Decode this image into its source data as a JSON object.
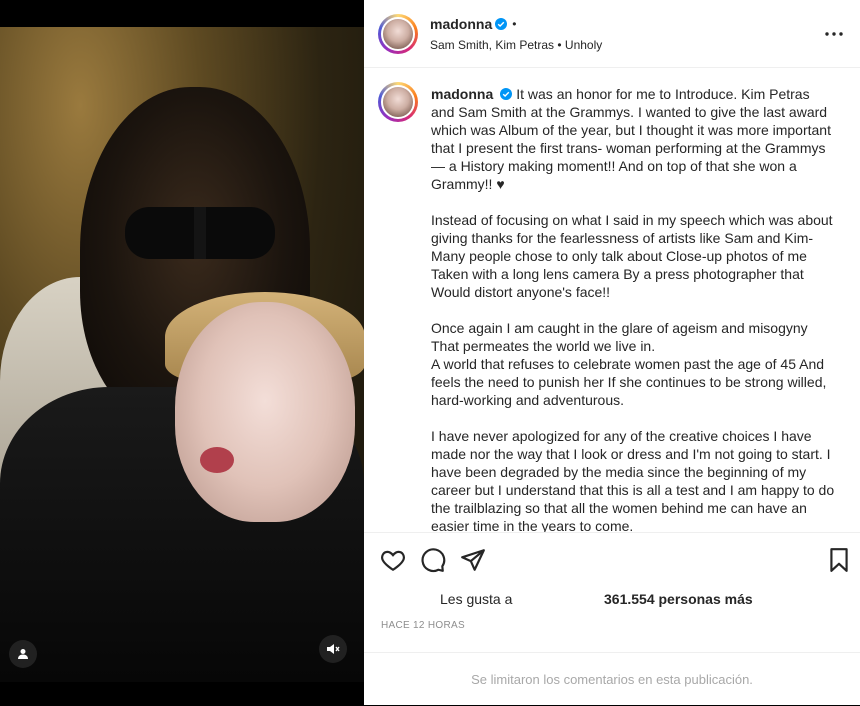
{
  "post": {
    "username": "madonna",
    "dot": "•",
    "song": "Sam Smith, Kim Petras • Unholy"
  },
  "caption": {
    "username": "madonna",
    "p1": "It was an honor for me to Introduce. Kim Petras and Sam Smith at the Grammys. I wanted to give the last award which was Album of the year, but I thought it was more important that I present the first trans- woman performing at the Grammys— a History making moment!! And on top of that she won a Grammy!! ♥",
    "p2": "Instead of focusing on what I said in my speech which was about giving thanks for the fearlessness of artists like Sam and Kim- Many people chose to only talk about Close-up photos of me Taken with a long lens camera By a press photographer that Would distort anyone's face!!",
    "p3a": "Once again I am caught in the glare of ageism and misogyny That permeates the world we live in.",
    "p3b": "A world that refuses to celebrate women past the age of 45 And feels the need to punish her If she continues to be strong willed, hard-working and adventurous.",
    "p4": "I have never apologized for any of the creative choices I have made nor the way that I look or dress and I'm not going to start. I have been degraded by the media since the beginning of my career but I understand that this is all a test and I am happy to do the trailblazing so that all the women behind me can have an easier time in the years to come."
  },
  "likes": {
    "prefix": "Les gusta a",
    "count": "361.554 personas más"
  },
  "timestamp": "HACE 12 HORAS",
  "comments_notice": "Se limitaron los comentarios en esta publicación.",
  "icons": {
    "user": "user-icon",
    "mute": "muted-speaker-icon",
    "more": "more-options-icon",
    "like": "heart-icon",
    "comment": "comment-icon",
    "share": "paper-plane-icon",
    "save": "bookmark-icon",
    "verified": "verified-badge-icon"
  },
  "colors": {
    "verified": "#0095f6",
    "muted_text": "#8e8e8e"
  }
}
